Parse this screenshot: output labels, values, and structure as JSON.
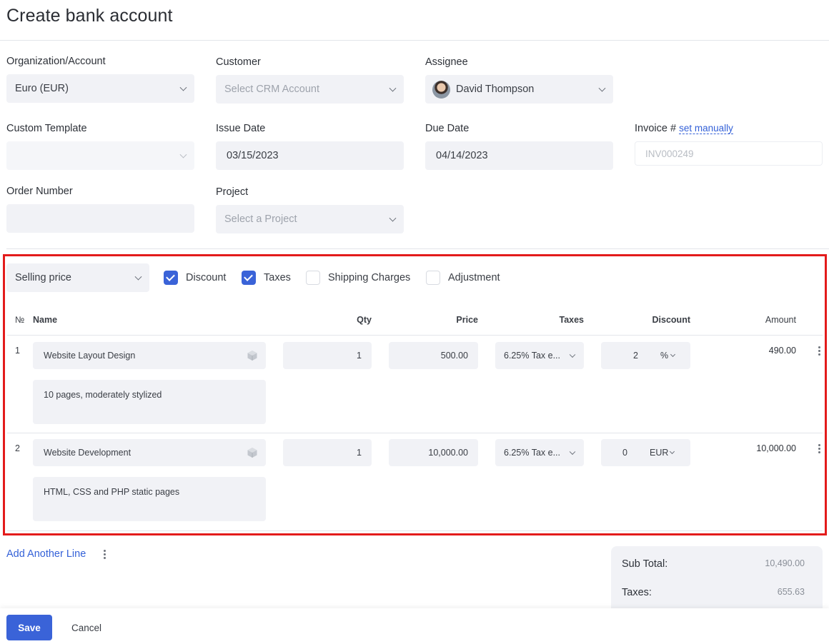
{
  "page": {
    "title": "Create bank account"
  },
  "form": {
    "organization": {
      "label": "Organization/Account",
      "value": "Euro (EUR)"
    },
    "customer": {
      "label": "Customer",
      "placeholder": "Select CRM Account"
    },
    "assignee": {
      "label": "Assignee",
      "value": "David Thompson"
    },
    "custom_template": {
      "label": "Custom Template",
      "value": ""
    },
    "issue_date": {
      "label": "Issue Date",
      "value": "03/15/2023"
    },
    "due_date": {
      "label": "Due Date",
      "value": "04/14/2023"
    },
    "invoice": {
      "label": "Invoice #",
      "link": "set manually",
      "placeholder": "INV000249"
    },
    "order_number": {
      "label": "Order Number",
      "value": ""
    },
    "project": {
      "label": "Project",
      "placeholder": "Select a Project"
    }
  },
  "options": {
    "price_type": "Selling price",
    "checkboxes": [
      {
        "label": "Discount",
        "checked": true
      },
      {
        "label": "Taxes",
        "checked": true
      },
      {
        "label": "Shipping Charges",
        "checked": false
      },
      {
        "label": "Adjustment",
        "checked": false
      }
    ]
  },
  "table": {
    "headers": {
      "num": "№",
      "name": "Name",
      "qty": "Qty",
      "price": "Price",
      "taxes": "Taxes",
      "discount": "Discount",
      "amount": "Amount"
    },
    "rows": [
      {
        "num": "1",
        "name": "Website Layout Design",
        "description": "10 pages, moderately stylized",
        "qty": "1",
        "price": "500.00",
        "tax": "6.25% Tax e...",
        "discount": "2",
        "discount_unit": "%",
        "amount": "490.00"
      },
      {
        "num": "2",
        "name": "Website Development",
        "description": "HTML, CSS and PHP static pages",
        "qty": "1",
        "price": "10,000.00",
        "tax": "6.25% Tax e...",
        "discount": "0",
        "discount_unit": "EUR",
        "amount": "10,000.00"
      }
    ]
  },
  "add_line": "Add Another Line",
  "totals": {
    "subtotal_label": "Sub Total:",
    "subtotal": "10,490.00",
    "taxes_label": "Taxes:",
    "taxes": "655.63"
  },
  "footer": {
    "save": "Save",
    "cancel": "Cancel"
  },
  "colors": {
    "accent": "#3a63d8",
    "highlight": "#e31b1b",
    "field_bg": "#f1f2f6"
  }
}
